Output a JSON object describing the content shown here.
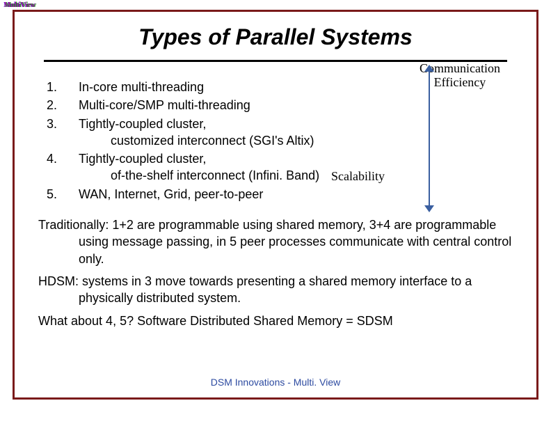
{
  "logo_text": "MultiView",
  "title": "Types of Parallel Systems",
  "axis_top_label_line1": "Communication",
  "axis_top_label_line2": "Efficiency",
  "axis_mid_label": "Scalability",
  "items": [
    {
      "num": "1.",
      "text": "In-core multi-threading"
    },
    {
      "num": "2.",
      "text": "Multi-core/SMP multi-threading"
    },
    {
      "num": "3.",
      "text": "Tightly-coupled cluster,",
      "sub": "customized interconnect (SGI's Altix)"
    },
    {
      "num": "4.",
      "text": "Tightly-coupled cluster,",
      "sub": "of-the-shelf interconnect (Infini. Band)"
    },
    {
      "num": "5.",
      "text": "WAN, Internet, Grid, peer-to-peer"
    }
  ],
  "para1": "Traditionally: 1+2 are programmable using shared memory, 3+4 are programmable using message passing, in 5 peer processes communicate with central control only.",
  "para2": "HDSM: systems in 3 move towards presenting a shared memory interface to a physically distributed system.",
  "para3": "What about 4, 5? Software Distributed Shared Memory = SDSM",
  "footer": "DSM Innovations  - Multi. View"
}
